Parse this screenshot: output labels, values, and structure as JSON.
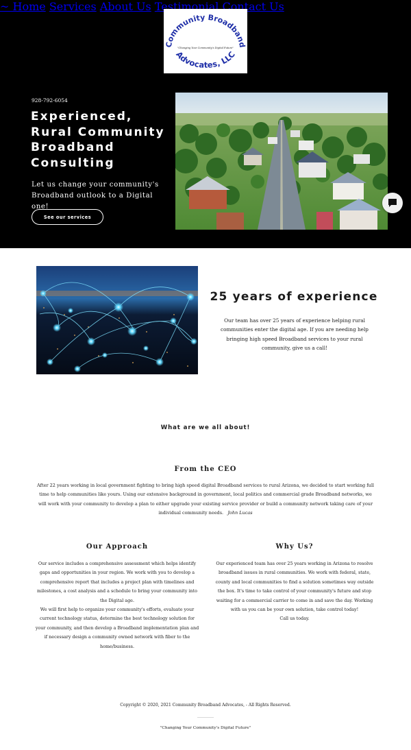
{
  "nav": {
    "home": "~ Home",
    "services": "Services",
    "about": "About Us",
    "testimonial": "Testimonial",
    "contact": "Contact Us"
  },
  "logo": {
    "line1": "Community Broadband",
    "line2": "Advocates, LLC",
    "tagline": "\"Changing Your Community's Digital Future\""
  },
  "hero": {
    "phone": "928-792-6054",
    "title_lines": [
      "Experienced,",
      "Rural Community",
      "Broadband",
      "Consulting"
    ],
    "subtitle": "Let us change your community's Broadband outlook to a Digital one!",
    "cta": "See our services"
  },
  "experience": {
    "title": "25 years of experience",
    "text": "Our team has over 25 years of experience helping rural communities enter the digital age.   If you are needing help bringing high speed Broadband services to your rural community, give us a call!"
  },
  "about": {
    "heading": "What are we all about!",
    "ceo_heading": "From the CEO",
    "ceo_text": "After 22 years working in local government fighting to bring high speed digital Broadband services to rural Arizona, we decided to start working full time to help communities like yours.  Using our extensive background in government, local politics and commercial grade Broadband networks, we will work with your community to develop a plan to either upgrade your existing service provider or build a community network taking care of your individual community needs.",
    "ceo_signature": "John Lucas",
    "approach_heading": "Our Approach",
    "approach_p1": "Our service includes a comprehensive assessment which helps identify gaps and opportunities in your region.   We work with you to develop a comprehensive report that includes a project plan with timelines and milestones, a cost analysis and a schedule to bring your community into the Digital age.",
    "approach_p2": "We will first help to organize your community's efforts, evaluate your current technology status, determine the best technology solution for your community,  and then develop a Broadband implementation plan and if necessary design a community owned network with fiber to the home/business.",
    "why_heading": "Why Us?",
    "why_p1": "Our experienced team has over 25 years working in Arizona to resolve broadband issues in rural communities.  We work with federal, state, county and local communities to find a solution sometimes way outside the box.  It's time to take control of your community's future and stop waiting for a commercial carrier to come in and save the day.  Working with us you can be your own solution, take control today!",
    "why_p2": "Call us today."
  },
  "footer": {
    "copyright": "Copyright © 2020, 2021 Community Broadband Advocates, - All Rights Reserved.",
    "tagline": "\"Changing Your Community's Digital Future\""
  },
  "icons": {
    "chat": "chat-bubble-icon"
  },
  "colors": {
    "hero_bg": "#000000",
    "logo_text": "#1f2fa8",
    "text": "#1b1b1b"
  }
}
